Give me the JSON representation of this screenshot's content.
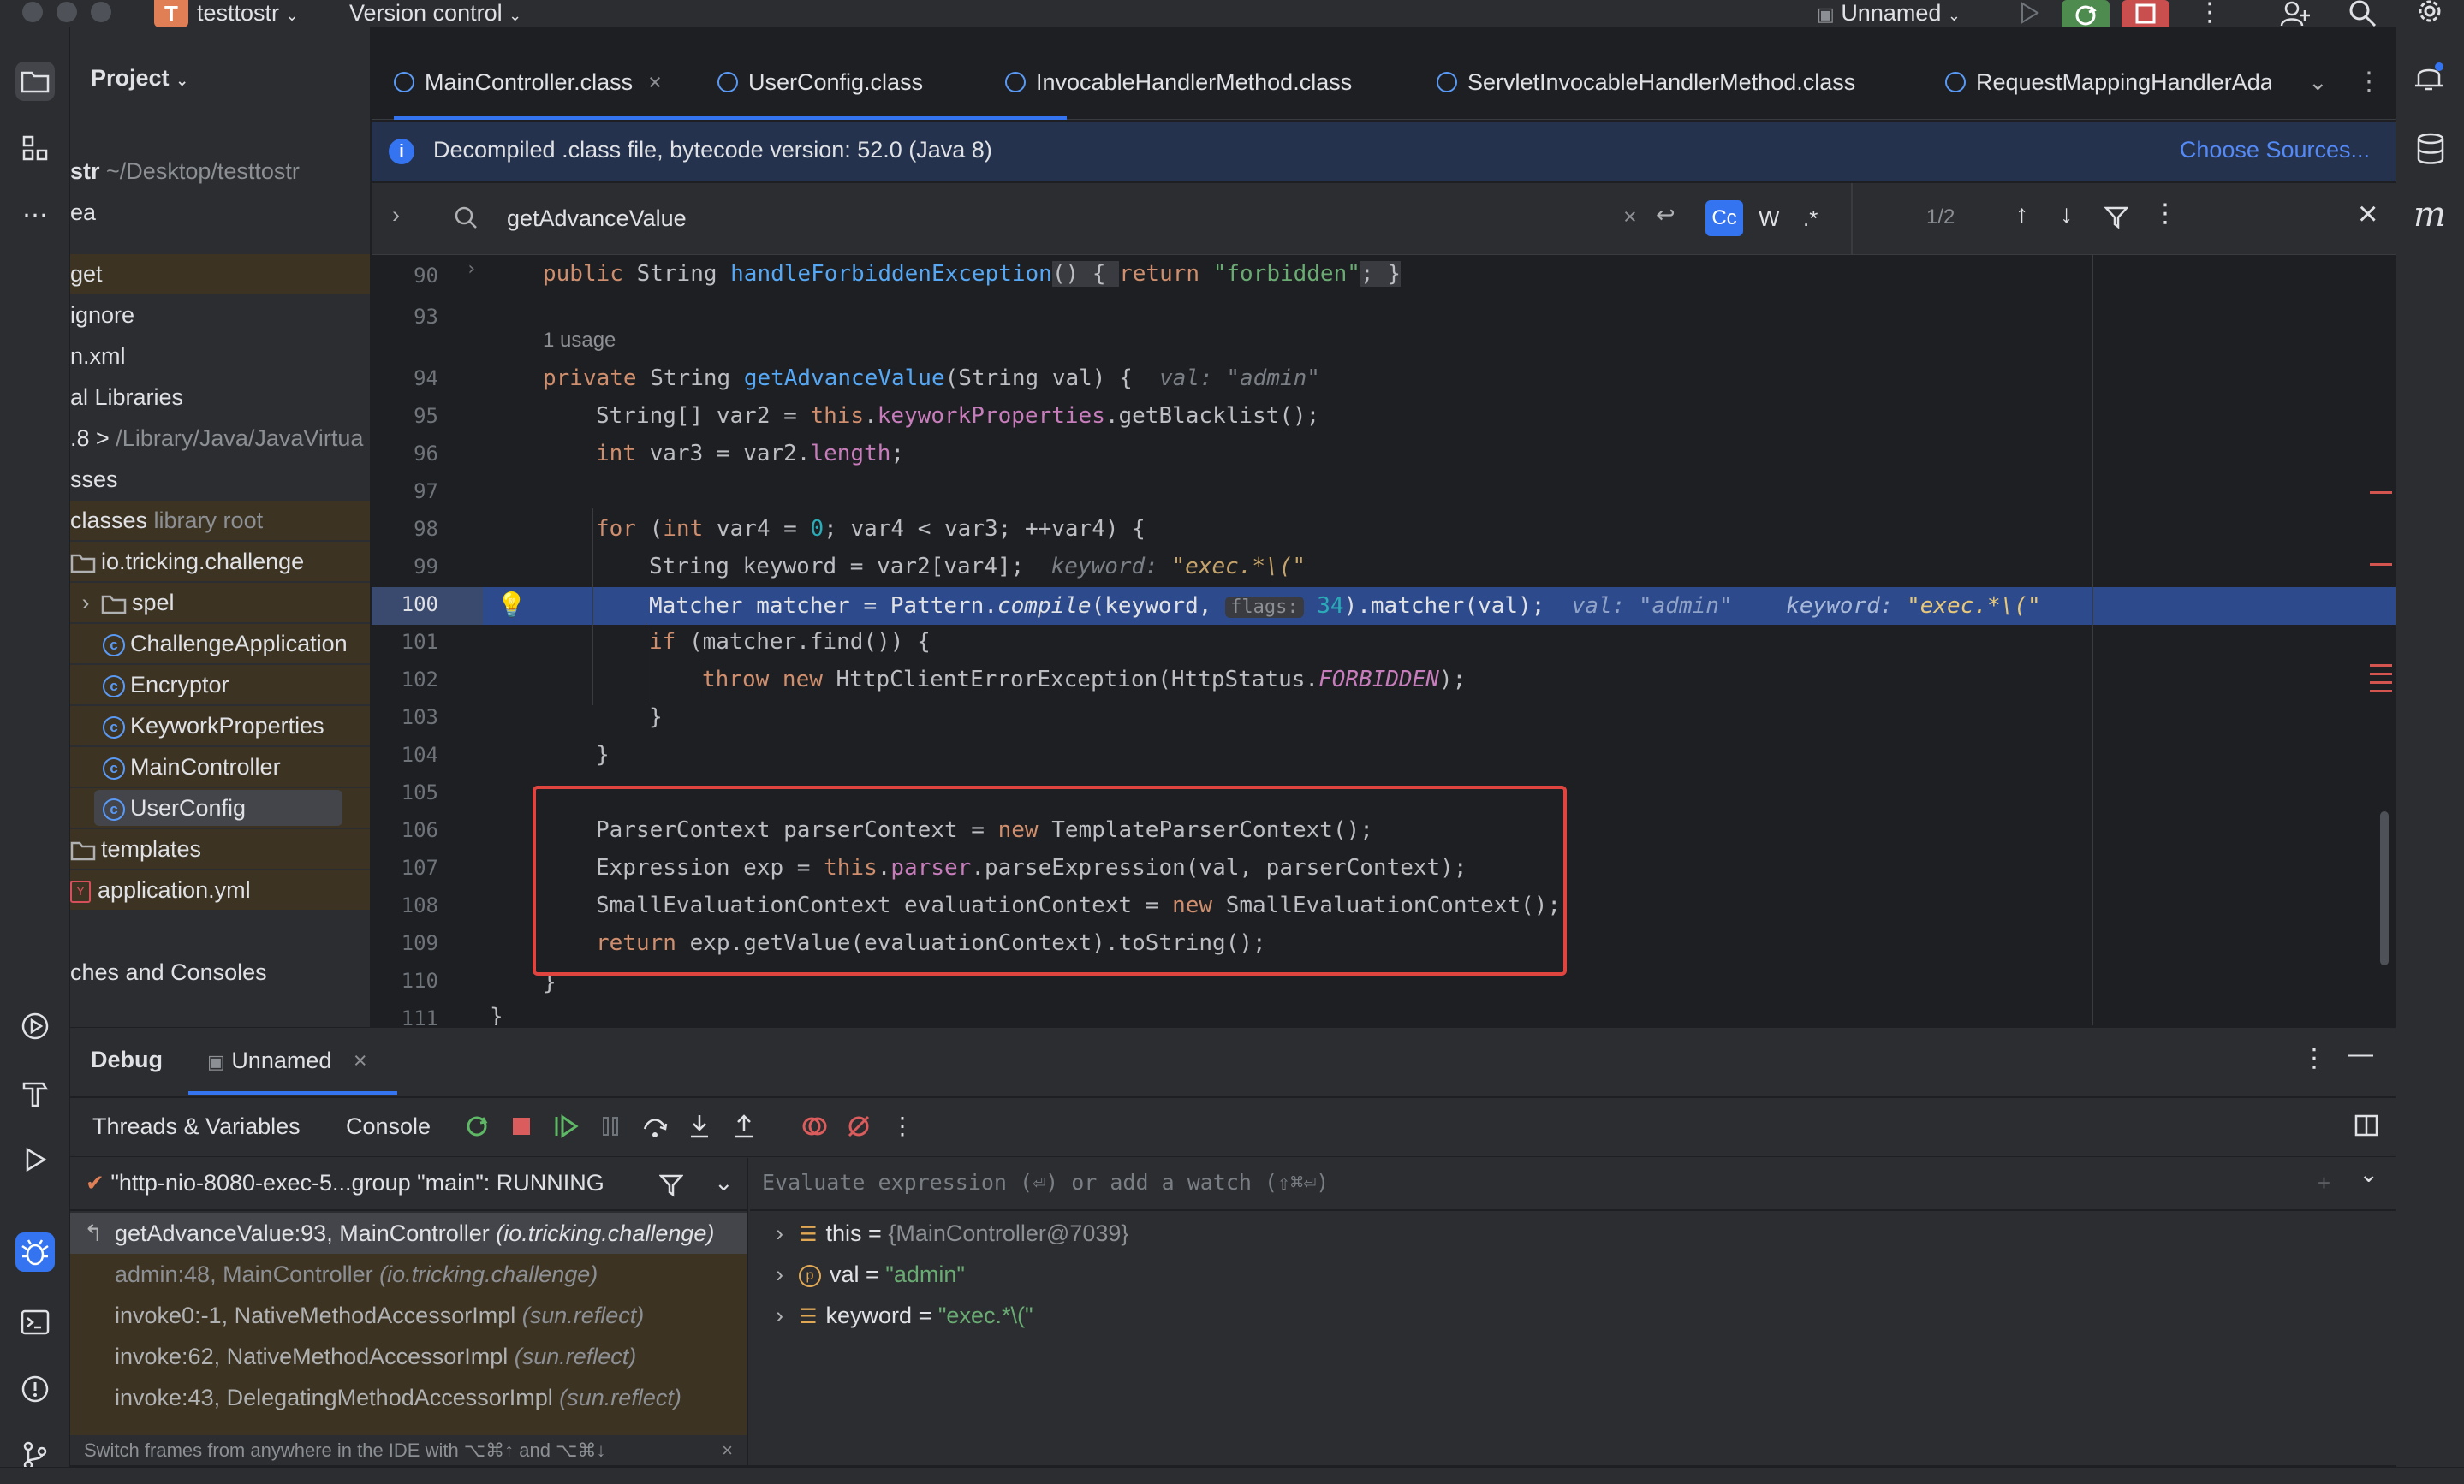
{
  "titlebar": {
    "project_badge": "T",
    "project_name": "testtostr",
    "vcs": "Version control",
    "run_config": "Unnamed"
  },
  "project_panel": {
    "title": "Project",
    "root_name": "str",
    "root_path": "~/Desktop/testtostr",
    "items": [
      {
        "label": "ea",
        "dim": ""
      },
      {
        "label": "get",
        "dim": ""
      },
      {
        "label": "ignore",
        "dim": ""
      },
      {
        "label": "n.xml",
        "dim": ""
      },
      {
        "label": "al Libraries",
        "dim": ""
      },
      {
        "label": ".8 > ",
        "dim": "/Library/Java/JavaVirtua"
      },
      {
        "label": "sses",
        "dim": ""
      },
      {
        "label": "classes",
        "dim": "library root"
      },
      {
        "label": "io.tricking.challenge",
        "dim": ""
      },
      {
        "label": "spel",
        "dim": ""
      },
      {
        "label": "ChallengeApplication",
        "dim": ""
      },
      {
        "label": "Encryptor",
        "dim": ""
      },
      {
        "label": "KeyworkProperties",
        "dim": ""
      },
      {
        "label": "MainController",
        "dim": ""
      },
      {
        "label": "UserConfig",
        "dim": ""
      },
      {
        "label": "templates",
        "dim": ""
      },
      {
        "label": "application.yml",
        "dim": ""
      },
      {
        "label": "ches and Consoles",
        "dim": ""
      }
    ]
  },
  "editor": {
    "tabs": [
      {
        "label": "MainController.class"
      },
      {
        "label": "UserConfig.class"
      },
      {
        "label": "InvocableHandlerMethod.class"
      },
      {
        "label": "ServletInvocableHandlerMethod.class"
      },
      {
        "label": "RequestMappingHandlerAda"
      }
    ],
    "banner_text": "Decompiled .class file, bytecode version: 52.0 (Java 8)",
    "banner_link": "Choose Sources...",
    "find_query": "getAdvanceValue",
    "find_count": "1/2",
    "find_opt_cc": "Cc",
    "find_opt_w": "W",
    "find_opt_re": ".*",
    "usage_hint": "1 usage",
    "lines": [
      "90",
      "93",
      "94",
      "95",
      "96",
      "97",
      "98",
      "99",
      "100",
      "101",
      "102",
      "103",
      "104",
      "105",
      "106",
      "107",
      "108",
      "109",
      "110",
      "111"
    ],
    "code": {
      "l90_a": "public ",
      "l90_b": "String ",
      "l90_c": "handleForbiddenException",
      "l90_d": "() ",
      "l90_e": "{ ",
      "l90_f": "return ",
      "l90_g": "\"forbidden\"",
      "l90_h": "; }",
      "l94_a": "private ",
      "l94_b": "String ",
      "l94_c": "getAdvanceValue",
      "l94_d": "(String val) {",
      "l94_hint": "val: \"admin\"",
      "l95_a": "String[] var2 = ",
      "l95_b": "this",
      "l95_c": ".",
      "l95_d": "keyworkProperties",
      "l95_e": ".getBlacklist();",
      "l96_a": "int ",
      "l96_b": "var3 = var2.",
      "l96_c": "length",
      "l96_d": ";",
      "l98_a": "for ",
      "l98_b": "(",
      "l98_c": "int ",
      "l98_d": "var4 = ",
      "l98_e": "0",
      "l98_f": "; var4 < var3; ++var4) {",
      "l99_a": "String keyword = var2[var4];",
      "l99_hint_k": "keyword: ",
      "l99_hint_v": "\"exec.*\\(\"",
      "l100_a": "Matcher matcher = Pattern.",
      "l100_b": "compile",
      "l100_c": "(keyword, ",
      "l100_inlay": "flags:",
      "l100_d": " 34",
      "l100_e": ").matcher(val);",
      "l100_hint1_k": "val: ",
      "l100_hint1_v": "\"admin\"",
      "l100_hint2_k": "keyword: ",
      "l100_hint2_v": "\"exec.*\\(\"",
      "l101_a": "if ",
      "l101_b": "(matcher.find()) {",
      "l102_a": "throw new ",
      "l102_b": "HttpClientErrorException(HttpStatus.",
      "l102_c": "FORBIDDEN",
      "l102_d": ");",
      "l103": "}",
      "l104": "}",
      "l106_a": "ParserContext parserContext = ",
      "l106_b": "new ",
      "l106_c": "TemplateParserContext();",
      "l107_a": "Expression exp = ",
      "l107_b": "this",
      "l107_c": ".",
      "l107_d": "parser",
      "l107_e": ".parseExpression(val, parserContext);",
      "l108_a": "SmallEvaluationContext evaluationContext = ",
      "l108_b": "new ",
      "l108_c": "SmallEvaluationContext();",
      "l109_a": "return ",
      "l109_b": "exp.getValue(evaluationContext).toString();",
      "l110": "}",
      "l111": "}"
    }
  },
  "debug": {
    "title": "Debug",
    "session": "Unnamed",
    "tab_threads": "Threads & Variables",
    "tab_console": "Console",
    "thread": "\"http-nio-8080-exec-5...group \"main\": RUNNING",
    "watch_placeholder": "Evaluate expression (⏎) or add a watch (⇧⌘⏎)",
    "frames": [
      {
        "text": "getAdvanceValue:93, MainController ",
        "pkg": "(io.tricking.challenge)"
      },
      {
        "text": "admin:48, MainController ",
        "pkg": "(io.tricking.challenge)"
      },
      {
        "text": "invoke0:-1, NativeMethodAccessorImpl ",
        "pkg": "(sun.reflect)"
      },
      {
        "text": "invoke:62, NativeMethodAccessorImpl ",
        "pkg": "(sun.reflect)"
      },
      {
        "text": "invoke:43, DelegatingMethodAccessorImpl ",
        "pkg": "(sun.reflect)"
      }
    ],
    "frames_hint": "Switch frames from anywhere in the IDE with ⌥⌘↑ and ⌥⌘↓",
    "variables": [
      {
        "name": "this",
        "eq": " = ",
        "value": "{MainController@7039}"
      },
      {
        "name": "val",
        "eq": " = ",
        "value": "\"admin\""
      },
      {
        "name": "keyword",
        "eq": " = ",
        "value": "\"exec.*\\(\""
      }
    ]
  },
  "colors": {
    "accent": "#3574f0",
    "highlight_box": "#e0443e",
    "execution_line": "#2d4b8c"
  }
}
